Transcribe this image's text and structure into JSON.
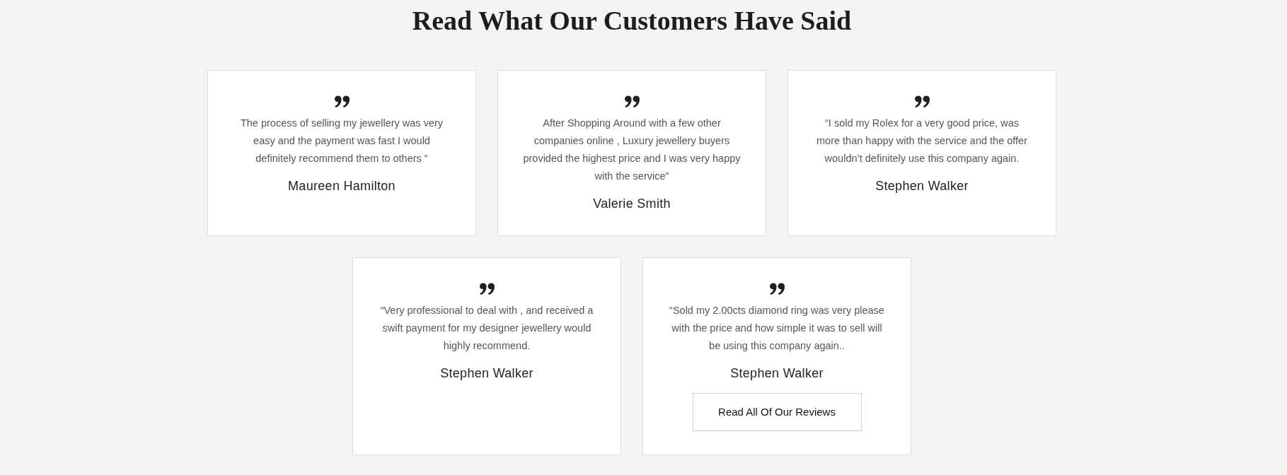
{
  "heading": "Read What Our Customers Have Said",
  "testimonials": [
    {
      "quote": "The process of selling my jewellery was very easy and the payment was fast I would definitely recommend them to others “",
      "author": "Maureen Hamilton"
    },
    {
      "quote": "After Shopping Around with a few other companies online , Luxury jewellery buyers provided the highest price and I was very happy with the service”",
      "author": "Valerie Smith"
    },
    {
      "quote": "“I sold my Rolex for a very good price, was more than happy with the service and the offer wouldn’t definitely use this company again.",
      "author": "Stephen Walker"
    },
    {
      "quote": "“Very professional to deal with , and received a swift payment for my designer jewellery would highly recommend.",
      "author": "Stephen Walker"
    },
    {
      "quote": "“Sold my 2.00cts diamond ring was very please with the price and how simple it was to sell will be using this company again..",
      "author": "Stephen Walker",
      "button": "Read All Of Our Reviews"
    }
  ]
}
